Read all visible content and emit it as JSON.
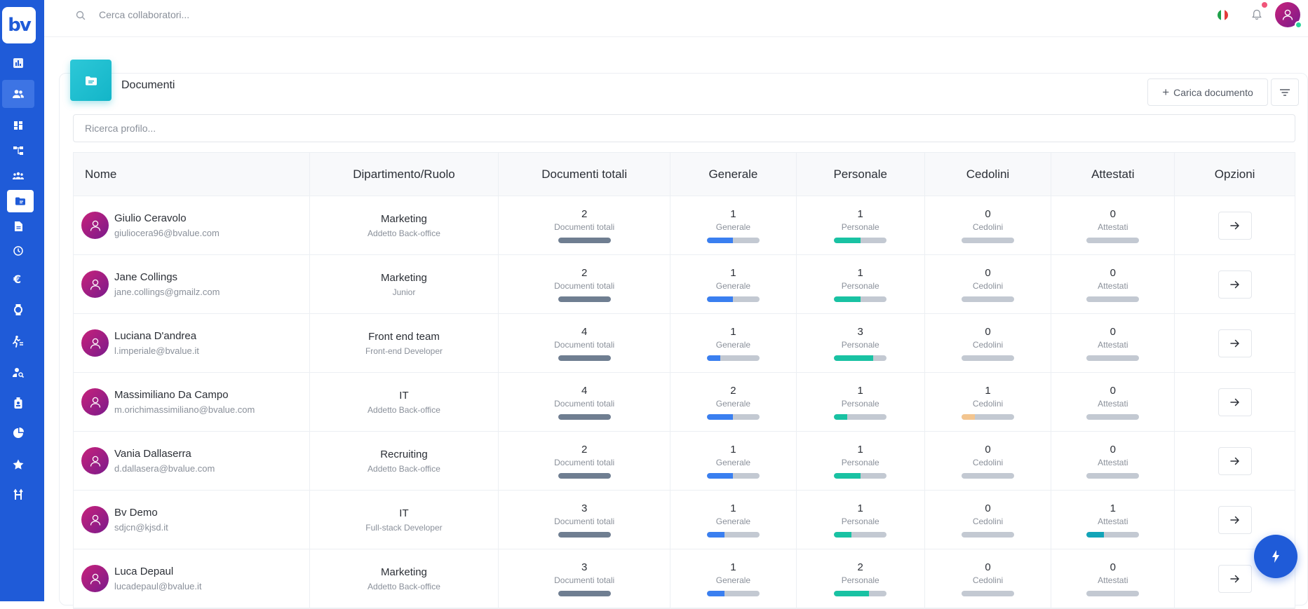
{
  "brand": {
    "logo_text": "bv",
    "color": "#1f5bd8"
  },
  "topbar": {
    "search_placeholder": "Cerca collaboratori..."
  },
  "sidebar": {
    "items": [
      {
        "icon": "chart-icon"
      },
      {
        "icon": "users-icon",
        "state": "highlighted"
      },
      {
        "icon": "dashboard-icon"
      },
      {
        "icon": "org-chart-icon"
      },
      {
        "icon": "team-icon"
      },
      {
        "icon": "folder-icon",
        "state": "active"
      },
      {
        "icon": "document-icon"
      },
      {
        "icon": "clock-icon"
      },
      {
        "icon": "euro-icon"
      },
      {
        "icon": "watch-icon"
      },
      {
        "icon": "activity-icon"
      },
      {
        "icon": "user-search-icon"
      },
      {
        "icon": "badge-icon"
      },
      {
        "icon": "pie-chart-icon"
      },
      {
        "icon": "star-icon"
      },
      {
        "icon": "split-icon"
      }
    ]
  },
  "page": {
    "title": "Documenti",
    "upload_label": "Carica documento",
    "profile_search_placeholder": "Ricerca profilo..."
  },
  "table": {
    "headers": [
      "Nome",
      "Dipartimento/Ruolo",
      "Documenti totali",
      "Generale",
      "Personale",
      "Cedolini",
      "Attestati",
      "Opzioni"
    ],
    "stat_labels": {
      "total": "Documenti totali",
      "general": "Generale",
      "personal": "Personale",
      "payslips": "Cedolini",
      "certificates": "Attestati"
    },
    "colors": {
      "total": "#6f7e91",
      "general": "#3a7ff0",
      "personal": "#19c2a3",
      "payslips": "#f3c58f",
      "certificates": "#12a4b8",
      "track": "#c3c9d2"
    },
    "rows": [
      {
        "name": "Giulio Ceravolo",
        "email": "giuliocera96@bvalue.com",
        "department": "Marketing",
        "role": "Addetto Back-office",
        "total": "2",
        "general": "1",
        "personal": "1",
        "payslips": "0",
        "certificates": "0",
        "total_pct": 1.0,
        "general_pct": 0.5,
        "personal_pct": 0.5,
        "payslips_pct": 0,
        "certificates_pct": 0
      },
      {
        "name": "Jane Collings",
        "email": "jane.collings@gmailz.com",
        "department": "Marketing",
        "role": "Junior",
        "total": "2",
        "general": "1",
        "personal": "1",
        "payslips": "0",
        "certificates": "0",
        "total_pct": 1.0,
        "general_pct": 0.5,
        "personal_pct": 0.5,
        "payslips_pct": 0,
        "certificates_pct": 0
      },
      {
        "name": "Luciana D'andrea",
        "email": "l.imperiale@bvalue.it",
        "department": "Front end team",
        "role": "Front-end Developer",
        "total": "4",
        "general": "1",
        "personal": "3",
        "payslips": "0",
        "certificates": "0",
        "total_pct": 1.0,
        "general_pct": 0.25,
        "personal_pct": 0.75,
        "payslips_pct": 0,
        "certificates_pct": 0
      },
      {
        "name": "Massimiliano Da Campo",
        "email": "m.orichimassimiliano@bvalue.com",
        "department": "IT",
        "role": "Addetto Back-office",
        "total": "4",
        "general": "2",
        "personal": "1",
        "payslips": "1",
        "certificates": "0",
        "total_pct": 1.0,
        "general_pct": 0.5,
        "personal_pct": 0.25,
        "payslips_pct": 0.25,
        "certificates_pct": 0
      },
      {
        "name": "Vania Dallaserra",
        "email": "d.dallasera@bvalue.com",
        "department": "Recruiting",
        "role": "Addetto Back-office",
        "total": "2",
        "general": "1",
        "personal": "1",
        "payslips": "0",
        "certificates": "0",
        "total_pct": 1.0,
        "general_pct": 0.5,
        "personal_pct": 0.5,
        "payslips_pct": 0,
        "certificates_pct": 0
      },
      {
        "name": "Bv Demo",
        "email": "sdjcn@kjsd.it",
        "department": "IT",
        "role": "Full-stack Developer",
        "total": "3",
        "general": "1",
        "personal": "1",
        "payslips": "0",
        "certificates": "1",
        "total_pct": 1.0,
        "general_pct": 0.33,
        "personal_pct": 0.33,
        "payslips_pct": 0,
        "certificates_pct": 0.33
      },
      {
        "name": "Luca Depaul",
        "email": "lucadepaul@bvalue.it",
        "department": "Marketing",
        "role": "Addetto Back-office",
        "total": "3",
        "general": "1",
        "personal": "2",
        "payslips": "0",
        "certificates": "0",
        "total_pct": 1.0,
        "general_pct": 0.33,
        "personal_pct": 0.67,
        "payslips_pct": 0,
        "certificates_pct": 0
      }
    ]
  }
}
